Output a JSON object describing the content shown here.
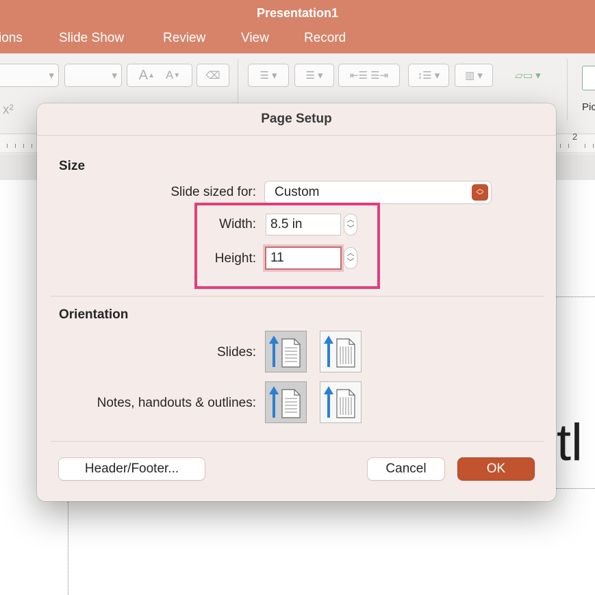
{
  "app": {
    "title": "Presentation1",
    "tabs": [
      "ions",
      "Slide Show",
      "Review",
      "View",
      "Record"
    ]
  },
  "ribbon": {
    "font_size_label": "A",
    "superscript_label": "x²",
    "partial_label": "Pic"
  },
  "ruler": {
    "mark_2": "2"
  },
  "background": {
    "partial_title": "itl"
  },
  "dialog": {
    "title": "Page Setup",
    "size": {
      "heading": "Size",
      "slide_sized_for_label": "Slide sized for:",
      "slide_sized_for_value": "Custom",
      "width_label": "Width:",
      "width_value": "8.5 in",
      "height_label": "Height:",
      "height_value": "11"
    },
    "orientation": {
      "heading": "Orientation",
      "slides_label": "Slides:",
      "notes_label": "Notes, handouts & outlines:",
      "slides_selected": "portrait",
      "notes_selected": "portrait"
    },
    "buttons": {
      "header_footer": "Header/Footer...",
      "cancel": "Cancel",
      "ok": "OK"
    }
  },
  "colors": {
    "accent": "#c2532f",
    "titlebar": "#d6836a",
    "highlight": "#e23d7d",
    "icon_blue": "#2b7fd6"
  },
  "icons": {
    "select_arrows": "up-down-chevron-icon",
    "stepper": "stepper-icon",
    "portrait": "portrait-orientation-icon",
    "landscape": "landscape-orientation-icon"
  }
}
